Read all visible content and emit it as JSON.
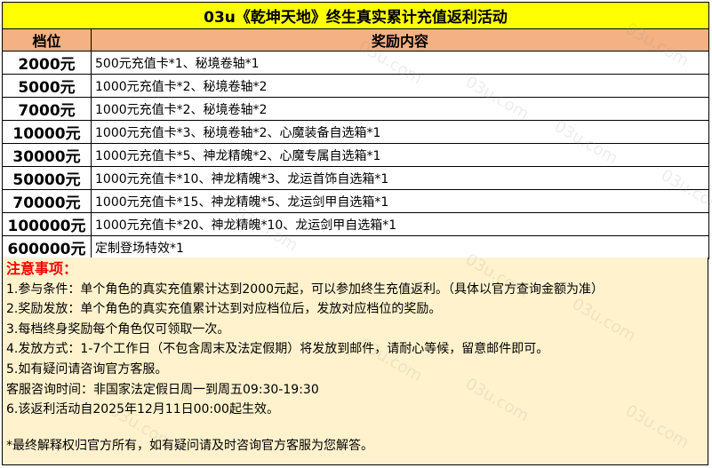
{
  "title": "03u《乾坤天地》终生真实累计充值返利活动",
  "headers": {
    "tier": "档位",
    "reward": "奖励内容"
  },
  "rows": [
    {
      "tier": "2000元",
      "reward": "500元充值卡*1、秘境卷轴*1"
    },
    {
      "tier": "5000元",
      "reward": "1000元充值卡*2、秘境卷轴*2"
    },
    {
      "tier": "7000元",
      "reward": "1000元充值卡*2、秘境卷轴*2"
    },
    {
      "tier": "10000元",
      "reward": "1000元充值卡*3、秘境卷轴*2、心魔装备自选箱*1"
    },
    {
      "tier": "30000元",
      "reward": "1000元充值卡*5、神龙精魄*2、心魔专属自选箱*1"
    },
    {
      "tier": "50000元",
      "reward": "1000元充值卡*10、神龙精魄*3、龙运首饰自选箱*1"
    },
    {
      "tier": "70000元",
      "reward": "1000元充值卡*15、神龙精魄*5、龙运剑甲自选箱*1"
    },
    {
      "tier": "100000元",
      "reward": "1000元充值卡*20、神龙精魄*10、龙运剑甲自选箱*1"
    },
    {
      "tier": "600000元",
      "reward": "定制登场特效*1"
    }
  ],
  "notes": {
    "title": "注意事项：",
    "lines": [
      "1.参与条件：单个角色的真实充值累计达到2000元起，可以参加终生充值返利。（具体以官方查询金额为准）",
      "2.奖励发放：单个角色的真实充值累计达到对应档位后，发放对应档位的奖励。",
      "3.每档终身奖励每个角色仅可领取一次。",
      "4.发放方式：1-7个工作日（不包含周末及法定假期）将发放到邮件，请耐心等候，留意邮件即可。",
      "5.如有疑问请咨询官方客服。",
      "客服咨询时间：非国家法定假日周一到周五09:30-19:30",
      "6.该返利活动自2025年12月11日00:00起生效。"
    ],
    "footnote": "*最终解释权归官方所有，如有疑问请及时咨询官方客服为您解答。"
  },
  "watermark": "03u.com",
  "colors": {
    "title_bg": "#ffff00",
    "header_bg": "#f4b183",
    "notes_bg": "#fff2cc",
    "notes_title": "#ff0000"
  }
}
